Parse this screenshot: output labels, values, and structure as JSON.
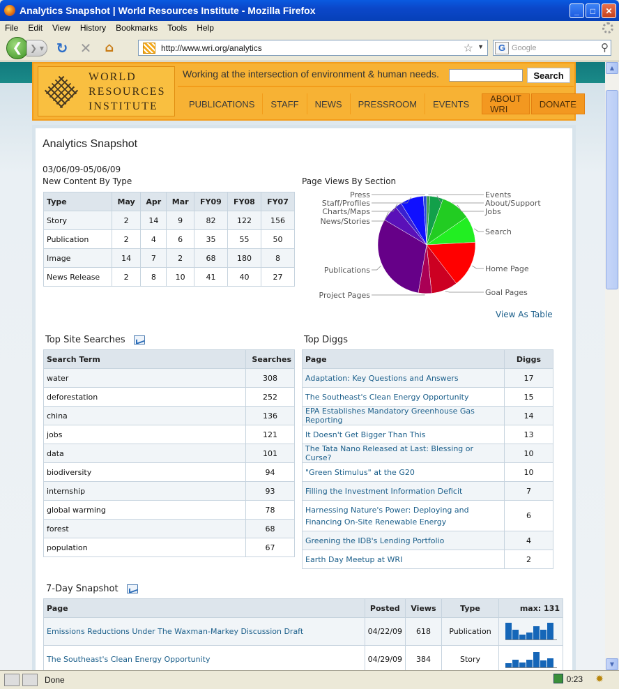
{
  "window": {
    "title": "Analytics Snapshot | World Resources Institute - Mozilla Firefox"
  },
  "menu": [
    "File",
    "Edit",
    "View",
    "History",
    "Bookmarks",
    "Tools",
    "Help"
  ],
  "url": "http://www.wri.org/analytics",
  "search_engine_placeholder": "Google",
  "status": {
    "text": "Done",
    "time": "0:23"
  },
  "header": {
    "logo_lines": [
      "WORLD",
      "RESOURCES",
      "INSTITUTE"
    ],
    "tagline": "Working at the intersection of environment & human needs.",
    "search_button": "Search",
    "nav": [
      "PUBLICATIONS",
      "STAFF",
      "NEWS",
      "PRESSROOM",
      "EVENTS"
    ],
    "nav_highlight": [
      "ABOUT WRI",
      "DONATE"
    ]
  },
  "page": {
    "title": "Analytics Snapshot",
    "date_range": "03/06/09-05/06/09",
    "content_heading": "New Content By Type",
    "content_columns": [
      "Type",
      "May",
      "Apr",
      "Mar",
      "FY09",
      "FY08",
      "FY07"
    ],
    "content_rows": [
      [
        "Story",
        "2",
        "14",
        "9",
        "82",
        "122",
        "156"
      ],
      [
        "Publication",
        "2",
        "4",
        "6",
        "35",
        "55",
        "50"
      ],
      [
        "Image",
        "14",
        "7",
        "2",
        "68",
        "180",
        "8"
      ],
      [
        "News Release",
        "2",
        "8",
        "10",
        "41",
        "40",
        "27"
      ]
    ],
    "pie_heading": "Page Views By Section",
    "view_as_table": "View As Table",
    "searches_heading": "Top Site Searches",
    "searches_columns": [
      "Search Term",
      "Searches"
    ],
    "searches_rows": [
      [
        "water",
        "308"
      ],
      [
        "deforestation",
        "252"
      ],
      [
        "china",
        "136"
      ],
      [
        "jobs",
        "121"
      ],
      [
        "data",
        "101"
      ],
      [
        "biodiversity",
        "94"
      ],
      [
        "internship",
        "93"
      ],
      [
        "global warming",
        "78"
      ],
      [
        "forest",
        "68"
      ],
      [
        "population",
        "67"
      ]
    ],
    "diggs_heading": "Top Diggs",
    "diggs_columns": [
      "Page",
      "Diggs"
    ],
    "diggs_rows": [
      [
        "Adaptation: Key Questions and Answers",
        "17"
      ],
      [
        "The Southeast's Clean Energy Opportunity",
        "15"
      ],
      [
        "EPA Establishes Mandatory Greenhouse Gas Reporting",
        "14"
      ],
      [
        "It Doesn't Get Bigger Than This",
        "13"
      ],
      [
        "The Tata Nano Released at Last: Blessing or Curse?",
        "10"
      ],
      [
        "\"Green Stimulus\" at the G20",
        "10"
      ],
      [
        "Filling the Investment Information Deficit",
        "7"
      ],
      [
        "Harnessing Nature's Power: Deploying and Financing On-Site Renewable Energy",
        "6"
      ],
      [
        "Greening the IDB's Lending Portfolio",
        "4"
      ],
      [
        "Earth Day Meetup at WRI",
        "2"
      ]
    ],
    "snapshot_heading": "7-Day Snapshot",
    "snapshot_columns": [
      "Page",
      "Posted",
      "Views",
      "Type",
      "max: 131"
    ],
    "snapshot_rows": [
      [
        "Emissions Reductions Under The Waxman-Markey Discussion Draft",
        "04/22/09",
        "618",
        "Publication"
      ],
      [
        "The Southeast's Clean Energy Opportunity",
        "04/29/09",
        "384",
        "Story"
      ]
    ],
    "snapshot_sparks": [
      [
        100,
        60,
        30,
        40,
        80,
        60,
        100
      ],
      [
        25,
        45,
        30,
        45,
        90,
        40,
        55
      ]
    ]
  },
  "chart_data": {
    "type": "pie",
    "title": "Page Views By Section",
    "categories": [
      "Events",
      "About/Support",
      "Jobs",
      "Search",
      "Home Page",
      "Goal Pages",
      "Project Pages",
      "Publications",
      "News/Stories",
      "Charts/Maps",
      "Staff/Profiles",
      "Press"
    ],
    "values": [
      1,
      4,
      9,
      8,
      14,
      8,
      4,
      28,
      5,
      2,
      7,
      1
    ],
    "colors": [
      "#3a9a4a",
      "#12a04a",
      "#22cc22",
      "#22ee22",
      "#ff0000",
      "#cc0022",
      "#aa0055",
      "#660088",
      "#5a10b8",
      "#3a20d0",
      "#1010ff",
      "#2a4ad8"
    ]
  }
}
